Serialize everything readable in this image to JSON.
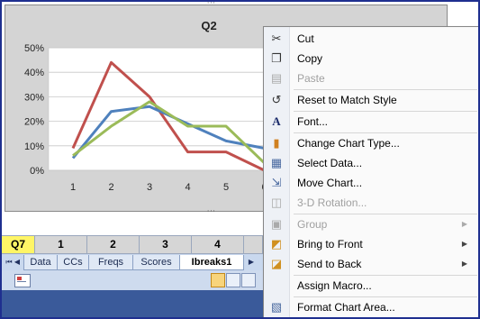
{
  "chart_data": {
    "type": "line",
    "title": "Q2",
    "categories": [
      "1",
      "2",
      "3",
      "4",
      "5",
      "6"
    ],
    "y_ticks": [
      "50%",
      "40%",
      "30%",
      "20%",
      "10%",
      "0%"
    ],
    "ylim": [
      0,
      0.5
    ],
    "grid": true,
    "series": [
      {
        "color": "#c0504d",
        "values": [
          0.09,
          0.44,
          0.3,
          0.075,
          0.075,
          0.0
        ]
      },
      {
        "color": "#4f81bd",
        "values": [
          0.05,
          0.24,
          0.26,
          0.19,
          0.12,
          0.09
        ]
      },
      {
        "color": "#9bbb59",
        "values": [
          0.06,
          0.18,
          0.28,
          0.18,
          0.18,
          0.03
        ]
      }
    ]
  },
  "grid_row": [
    "Q7",
    "1",
    "2",
    "3",
    "4"
  ],
  "sheet_tabs": [
    "Data",
    "CCs",
    "Freqs",
    "Scores",
    "Ibreaks1"
  ],
  "nav_arrows": [
    "⏮",
    "◀",
    "▶"
  ],
  "context_menu": {
    "items": [
      {
        "label": "Cut",
        "icon": "✂",
        "name": "cut"
      },
      {
        "label": "Copy",
        "icon": "❐",
        "name": "copy"
      },
      {
        "label": "Paste",
        "icon": "▤",
        "name": "paste",
        "disabled": true
      },
      {
        "label": "Reset to Match Style",
        "icon": "↺",
        "name": "reset-to-match-style"
      },
      {
        "label": "Font...",
        "icon": "A",
        "name": "font"
      },
      {
        "label": "Change Chart Type...",
        "icon": "▮",
        "name": "change-chart-type"
      },
      {
        "label": "Select Data...",
        "icon": "▦",
        "name": "select-data"
      },
      {
        "label": "Move Chart...",
        "icon": "⇲",
        "name": "move-chart"
      },
      {
        "label": "3-D Rotation...",
        "icon": "◫",
        "name": "3d-rotation",
        "disabled": true
      },
      {
        "label": "Group",
        "icon": "▣",
        "name": "group",
        "disabled": true,
        "submenu": true
      },
      {
        "label": "Bring to Front",
        "icon": "◩",
        "name": "bring-to-front",
        "submenu": true
      },
      {
        "label": "Send to Back",
        "icon": "◪",
        "name": "send-to-back",
        "submenu": true
      },
      {
        "label": "Assign Macro...",
        "icon": "",
        "name": "assign-macro"
      },
      {
        "label": "Format Chart Area...",
        "icon": "▧",
        "name": "format-chart-area"
      }
    ]
  }
}
